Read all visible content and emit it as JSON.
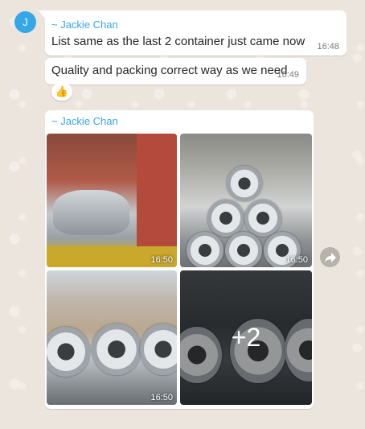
{
  "chat": {
    "avatar_initial": "J",
    "messages": [
      {
        "sender": "~ Jackie Chan",
        "text": "List same as the last 2 container just came now",
        "time": "16:48"
      },
      {
        "text": "Quality and packing correct way as we need",
        "time": "16:49",
        "reaction": "👍"
      }
    ],
    "album": {
      "sender": "~ Jackie Chan",
      "photos": [
        {
          "time": "16:50"
        },
        {
          "time": "16:50"
        },
        {
          "time": "16:50"
        },
        {
          "more_count": "+2"
        }
      ]
    }
  },
  "colors": {
    "sender": "#35a6e8",
    "background": "#ece5dd",
    "bubble": "#ffffff"
  },
  "icons": {
    "forward": "forward-arrow-icon",
    "reaction": "thumbs-up-icon"
  }
}
